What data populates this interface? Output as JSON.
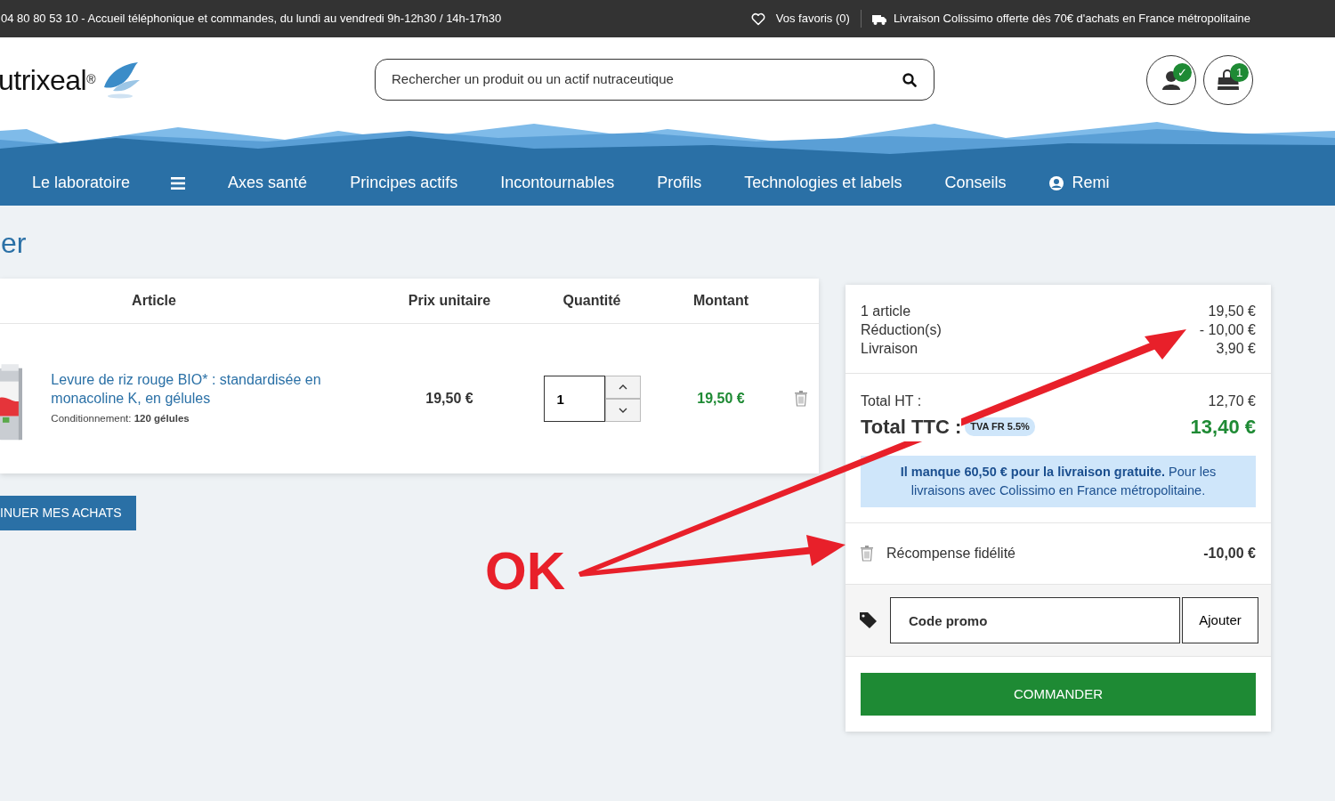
{
  "top_bar": {
    "contact": "04 80 80 53 10 - Accueil téléphonique et commandes, du lundi au vendredi 9h-12h30 / 14h-17h30",
    "favorites": "Vos favoris (0)",
    "shipping": "Livraison Colissimo offerte dès 70€ d'achats en France métropolitaine"
  },
  "header": {
    "logo": "utrixeal",
    "logo_mark": "®",
    "search": {
      "placeholder": "Rechercher un produit ou un actif nutraceutique"
    },
    "account_badge": "✓",
    "cart_badge": "1"
  },
  "nav": [
    {
      "kind": "text",
      "label": "Le laboratoire"
    },
    {
      "kind": "menu"
    },
    {
      "kind": "text",
      "label": "Axes santé"
    },
    {
      "kind": "text",
      "label": "Principes actifs"
    },
    {
      "kind": "text",
      "label": "Incontournables"
    },
    {
      "kind": "text",
      "label": "Profils"
    },
    {
      "kind": "text",
      "label": "Technologies et labels"
    },
    {
      "kind": "text",
      "label": "Conseils"
    },
    {
      "kind": "user",
      "label": "Remi"
    }
  ],
  "page_title": "er",
  "cart": {
    "columns": [
      "Article",
      "Prix unitaire",
      "Quantité",
      "Montant"
    ],
    "items": [
      {
        "name": "Levure de riz rouge BIO* : standardisée en monacoline K, en gélules",
        "packaging": "Conditionnement: **120 gélules**",
        "unit_price": "19,50 €",
        "quantity": "1",
        "amount": "19,50 €"
      }
    ]
  },
  "continue_button": "INUER MES ACHATS",
  "summary": {
    "lines": [
      {
        "label": "1 article",
        "value": "19,50 €"
      },
      {
        "label": "Réduction(s)",
        "value": "- 10,00 €"
      },
      {
        "label": "Livraison",
        "value": "3,90 €"
      }
    ],
    "total_ht": {
      "label": "Total HT :",
      "value": "12,70 €"
    },
    "total_ttc": {
      "label": "Total TTC :",
      "badge": "TVA FR 5.5%",
      "value": "13,40 €"
    },
    "notice": "**Il manque 60,50 € pour la livraison gratuite.**  Pour les livraisons avec Colissimo en France métropolitaine.",
    "reward": {
      "label": "Récompense fidélité",
      "value": "-10,00 €"
    },
    "promo": {
      "placeholder": "Code promo",
      "button": "Ajouter"
    },
    "checkout": "COMMANDER"
  },
  "annotation": {
    "label": "OK"
  }
}
